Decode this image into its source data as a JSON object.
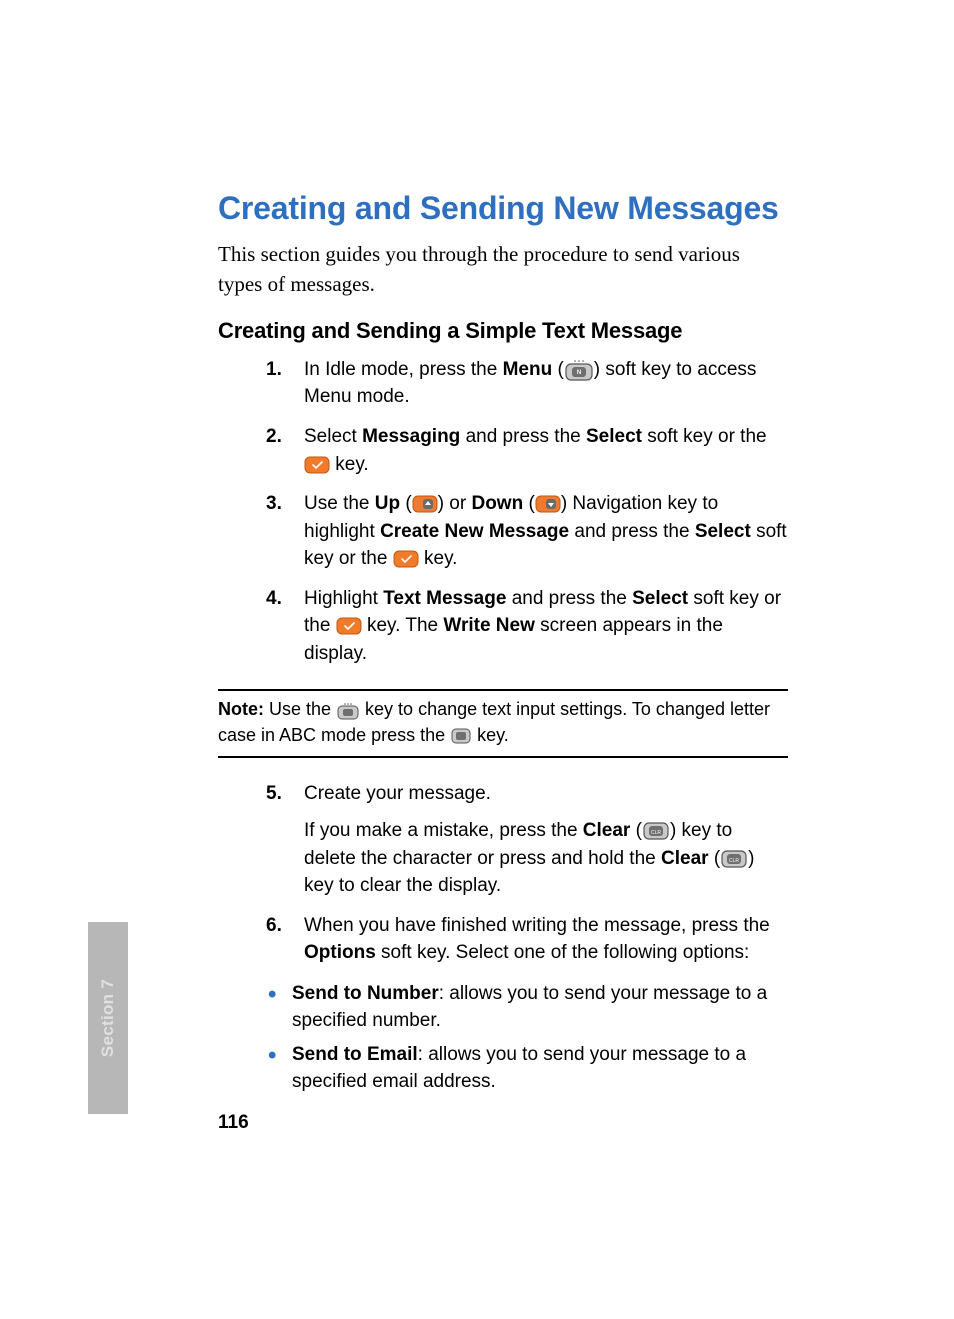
{
  "heading": "Creating and Sending New Messages",
  "intro": "This section guides you through the procedure to send various types of messages.",
  "subheading": "Creating and Sending a Simple Text Message",
  "steps": {
    "s1": {
      "a": "In Idle mode, press the ",
      "menu": "Menu",
      "b": " (",
      "c": ") soft key to access Menu mode."
    },
    "s2": {
      "a": "Select ",
      "messaging": "Messaging",
      "b": " and press the ",
      "select": "Select",
      "c": " soft key or the ",
      "d": " key."
    },
    "s3": {
      "a": "Use the ",
      "up": "Up",
      "b": " (",
      "c": ") or ",
      "down": "Down",
      "d": " (",
      "e": ") Navigation key to highlight ",
      "create": "Create New Message",
      "f": " and press the ",
      "select": "Select",
      "g": " soft key or the ",
      "h": " key."
    },
    "s4": {
      "a": "Highlight ",
      "text": "Text Message",
      "b": " and press the ",
      "select": "Select",
      "c": " soft key or the ",
      "d": " key. The ",
      "write": "Write New",
      "e": " screen appears in the display."
    },
    "s5": {
      "a": "Create your message.",
      "p2a": "If you make a mistake, press the ",
      "clear": "Clear",
      "p2b": " (",
      "p2c": ") key to delete the character or press and hold the ",
      "clear2": "Clear",
      "p2d": " (",
      "p2e": ") key to clear the display."
    },
    "s6": {
      "a": "When you have finished writing the message, press the ",
      "options": "Options",
      "b": " soft key. Select one of the following options:"
    }
  },
  "note": {
    "label": "Note:",
    "a": " Use the ",
    "b": " key to change text input settings. To changed letter case in ABC mode press the ",
    "c": " key."
  },
  "bullets": {
    "b1": {
      "title": "Send to Number",
      "rest": ": allows you to send your message to a specified number."
    },
    "b2": {
      "title": "Send to Email",
      "rest": ": allows you to send your message to a specified email address."
    }
  },
  "sideTab": "Section 7",
  "pageNumber": "116"
}
